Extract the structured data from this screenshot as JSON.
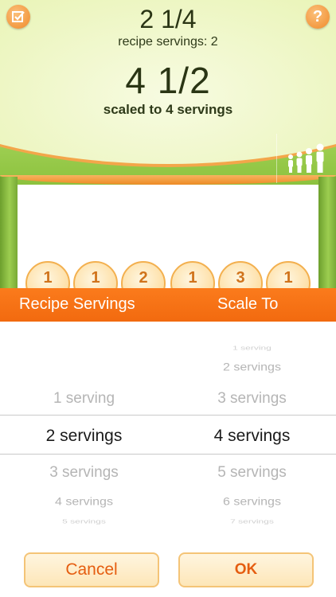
{
  "display": {
    "recipe_quantity": "2 1/4",
    "recipe_servings_text": "recipe servings: 2",
    "scaled_quantity": "4 1/2",
    "scaled_servings_text": "scaled to 4 servings"
  },
  "icons": {
    "top_left": "checklist-icon",
    "top_right": "help-icon",
    "people": "people-scale-icon"
  },
  "help_glyph": "?",
  "coins": [
    "1",
    "1",
    "2",
    "1",
    "3",
    "1"
  ],
  "picker": {
    "header_left": "Recipe Servings",
    "header_right": "Scale To",
    "left_rows": [
      "1 serving",
      "2 servings",
      "3 servings",
      "4 servings",
      "5 servings"
    ],
    "left_selected": "2 servings",
    "right_rows": [
      "1 serving",
      "2 servings",
      "3 servings",
      "4 servings",
      "5 servings",
      "6 servings",
      "7 servings"
    ],
    "right_selected": "4 servings"
  },
  "buttons": {
    "cancel": "Cancel",
    "ok": "OK"
  },
  "colors": {
    "accent_orange": "#f26a0f",
    "green": "#8cc23e"
  }
}
